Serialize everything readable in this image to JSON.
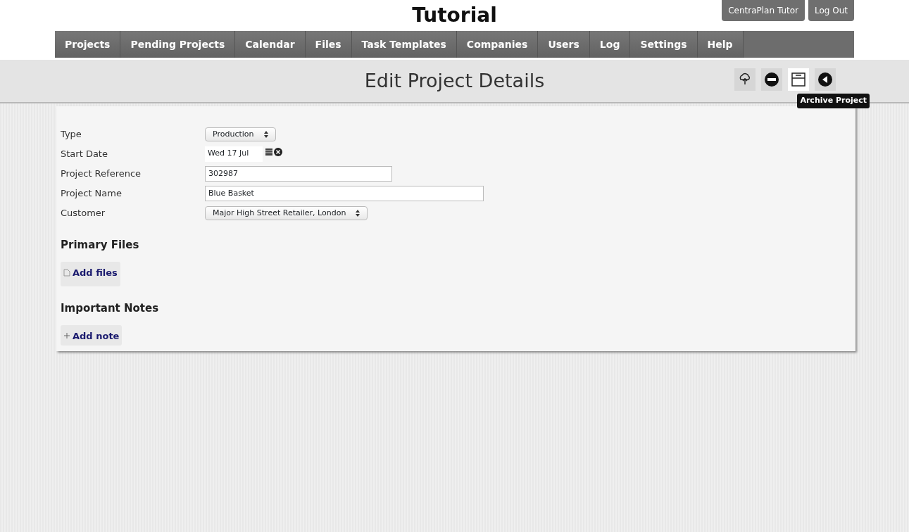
{
  "site_title": "Tutorial",
  "top_buttons": [
    "CentraPlan Tutor",
    "Log Out"
  ],
  "nav": [
    {
      "label": "Projects"
    },
    {
      "label": "Pending Projects"
    },
    {
      "label": "Calendar"
    },
    {
      "label": "Files"
    },
    {
      "label": "Task Templates"
    },
    {
      "label": "Companies"
    },
    {
      "label": "Users"
    },
    {
      "label": "Log"
    },
    {
      "label": "Settings"
    },
    {
      "label": "Help"
    }
  ],
  "page_title": "Edit Project Details",
  "toolbar": [
    {
      "kind": "upload",
      "hovered": false
    },
    {
      "kind": "remove",
      "hovered": false
    },
    {
      "kind": "archive",
      "hovered": true,
      "tooltip": "Archive Project"
    },
    {
      "kind": "back",
      "hovered": false
    }
  ],
  "fields": [
    {
      "label": "Type",
      "kind": "select",
      "value": "Production"
    },
    {
      "label": "Start Date",
      "kind": "date",
      "value": "Wed 17 Jul"
    },
    {
      "label": "Project Reference",
      "kind": "text",
      "value": "302987"
    },
    {
      "label": "Project Name",
      "kind": "longtext",
      "value": "Blue Basket"
    },
    {
      "label": "Customer",
      "kind": "select",
      "value": "Major High Street Retailer, London"
    }
  ],
  "sections": [
    {
      "heading": "Primary Files",
      "action": "Add files",
      "kind": "file"
    },
    {
      "heading": "Important Notes",
      "action": "Add note",
      "kind": "note"
    }
  ]
}
